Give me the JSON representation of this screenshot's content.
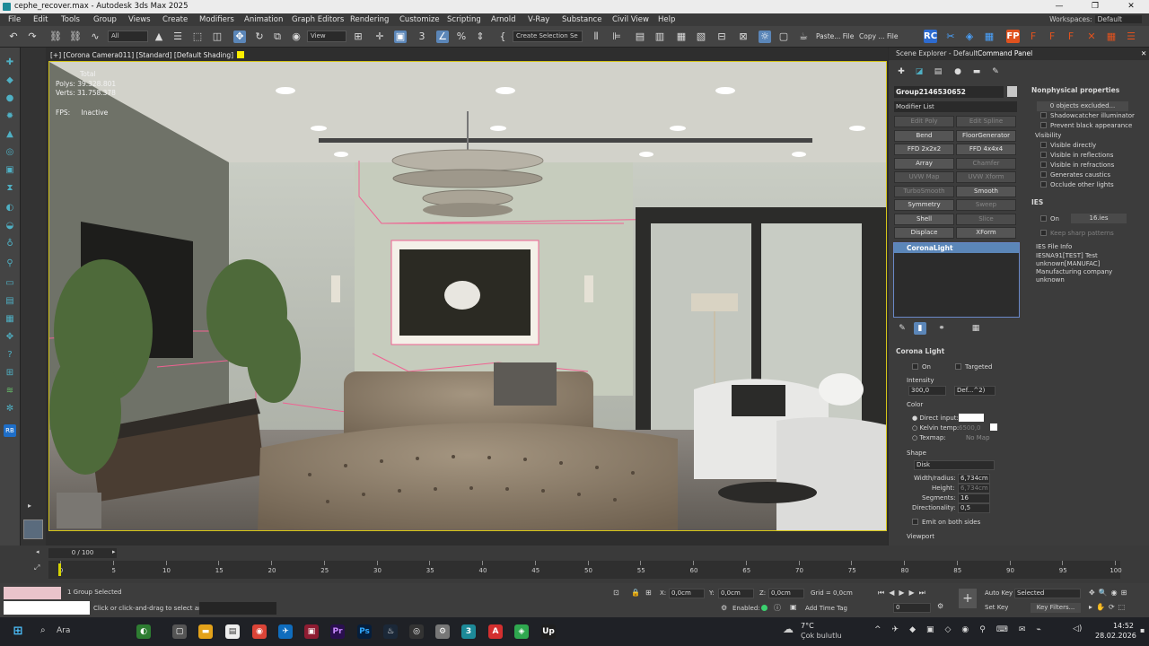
{
  "window": {
    "title": "cephe_recover.max - Autodesk 3ds Max 2025",
    "controls": [
      "—",
      "❐",
      "✕"
    ]
  },
  "menu": {
    "items": [
      "File",
      "Edit",
      "Tools",
      "Group",
      "Views",
      "Create",
      "Modifiers",
      "Animation",
      "Graph Editors",
      "Rendering",
      "Customize",
      "Scripting",
      "Arnold",
      "V-Ray",
      "Substance",
      "Civil View",
      "Help"
    ],
    "workspaces_label": "Workspaces:",
    "workspace_value": "Default"
  },
  "toolbar": {
    "selection_filter": "All",
    "ref_coord": "View",
    "create_selection_set": "Create Selection Se",
    "paste_file": "Paste... File",
    "copy_file": "Copy ... File",
    "rc_label": "RC",
    "fp_label": "FP"
  },
  "viewport": {
    "label": "[+] [Corona Camera011] [Standard] [Default Shading]",
    "stats_total_label": "Total",
    "polys_label": "Polys:",
    "polys_value": "39.328.801",
    "verts_label": "Verts:",
    "verts_value": "31.758.378",
    "fps_label": "FPS:",
    "fps_value": "Inactive"
  },
  "scene_tabs": {
    "scene_explorer": "Scene Explorer - Default",
    "command_panel": "Command Panel"
  },
  "command_panel": {
    "object_name": "Group2146530652",
    "modifier_list": "Modifier List",
    "modifiers": [
      [
        "Edit Poly",
        "Edit Spline"
      ],
      [
        "Bend",
        "FloorGenerator"
      ],
      [
        "FFD 2x2x2",
        "FFD 4x4x4"
      ],
      [
        "Array",
        "Chamfer"
      ],
      [
        "UVW Map",
        "UVW Xform"
      ],
      [
        "TurboSmooth",
        "Smooth"
      ],
      [
        "Symmetry",
        "Sweep"
      ],
      [
        "Shell",
        "Slice"
      ],
      [
        "Displace",
        "XForm"
      ]
    ],
    "modifier_disabled": [
      [
        true,
        true
      ],
      [
        false,
        false
      ],
      [
        false,
        false
      ],
      [
        false,
        true
      ],
      [
        true,
        true
      ],
      [
        true,
        false
      ],
      [
        false,
        true
      ],
      [
        false,
        true
      ],
      [
        false,
        false
      ]
    ],
    "stack_item": "CoronaLight",
    "rollout_title": "Corona Light",
    "on_label": "On",
    "targeted_label": "Targeted",
    "intensity_label": "Intensity",
    "intensity_value": "300,0",
    "intensity_unit": "Def...^2)",
    "color_label": "Color",
    "direct_input": "Direct input:",
    "kelvin_temp": "Kelvin temp:",
    "kelvin_value": "6500,0",
    "texmap": "Texmap:",
    "texmap_value": "No Map",
    "shape_label": "Shape",
    "shape_value": "Disk",
    "width_label": "Width/radius:",
    "width_value": "6,734cm",
    "height_label": "Height:",
    "height_value": "6,734cm",
    "segments_label": "Segments:",
    "segments_value": "16",
    "directionality_label": "Directionality:",
    "directionality_value": "0,5",
    "emit_both": "Emit on both sides",
    "viewport_label": "Viewport"
  },
  "right_panel": {
    "nonphysical_title": "Nonphysical properties",
    "objects_excluded": "0 objects excluded...",
    "shadowcatcher": "Shadowcatcher illuminator",
    "prevent_black": "Prevent black appearance",
    "visibility": "Visibility",
    "visible_directly": "Visible directly",
    "visible_reflections": "Visible in reflections",
    "visible_refractions": "Visible in refractions",
    "generates_caustics": "Generates caustics",
    "occlude_lights": "Occlude other lights",
    "ies_title": "IES",
    "ies_on": "On",
    "ies_file": "16.ies",
    "keep_sharp": "Keep sharp patterns",
    "ies_info_title": "IES File Info",
    "ies_info_text": "IESNA91[TEST]     Test unknown[MANUFAC] Manufacturing company unknown"
  },
  "timeline": {
    "frame_label": "0 / 100",
    "ticks": [
      "0",
      "5",
      "10",
      "15",
      "20",
      "25",
      "30",
      "35",
      "40",
      "45",
      "50",
      "55",
      "60",
      "65",
      "70",
      "75",
      "80",
      "85",
      "90",
      "95",
      "100"
    ]
  },
  "status": {
    "selection": "1 Group Selected",
    "prompt": "Click or click-and-drag to select and move objects",
    "x_label": "X:",
    "x_value": "0,0cm",
    "y_label": "Y:",
    "y_value": "0,0cm",
    "z_label": "Z:",
    "z_value": "0,0cm",
    "grid": "Grid = 0,0cm",
    "enabled": "Enabled:",
    "add_time_tag": "Add Time Tag",
    "auto_key": "Auto Key",
    "set_key": "Set Key",
    "selected": "Selected",
    "key_filters": "Key Filters...",
    "frame_value": "0"
  },
  "taskbar": {
    "search_placeholder": "Ara",
    "weather_temp": "7°C",
    "weather_text": "Çok bulutlu",
    "time": "14:52",
    "date": "28.02.2026",
    "apps": [
      "Pr",
      "Ps",
      "Up"
    ]
  },
  "colors": {
    "accent": "#5b86b8",
    "selection_yellow": "#d5c51a",
    "corona_orange": "#e0521e",
    "ies_pink": "#f06292"
  }
}
